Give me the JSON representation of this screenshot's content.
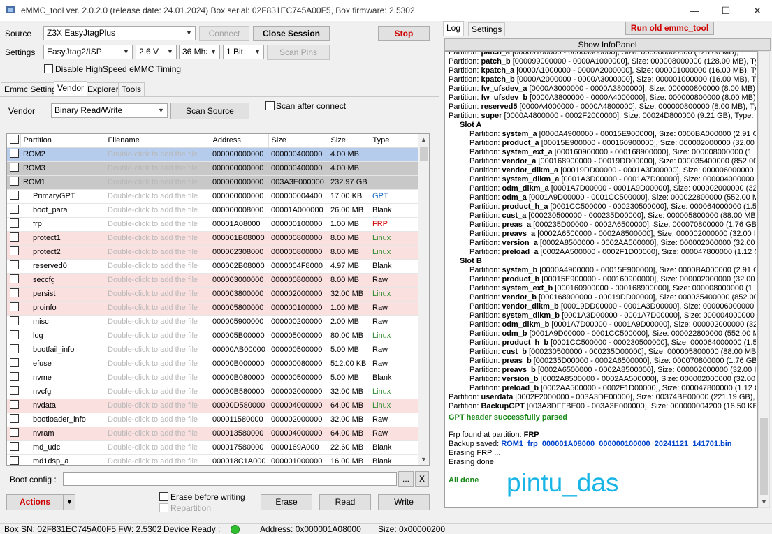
{
  "window": {
    "title": "eMMC_tool ver. 2.0.2.0 (release date: 24.01.2024) Box serial: 02F831EC745A00F5, Box firmware: 2.5302",
    "minimize": "—",
    "maximize": "☐",
    "close": "✕"
  },
  "source": {
    "label": "Source",
    "value": "Z3X EasyJtagPlus",
    "connect": "Connect",
    "close_session": "Close Session",
    "stop": "Stop"
  },
  "settings": {
    "label": "Settings",
    "iface": "EasyJtag2/ISP",
    "voltage": "2.6 V",
    "clock": "36 Mhz",
    "bus": "1 Bit",
    "scan_pins": "Scan Pins",
    "disable_hs": "Disable HighSpeed eMMC Timing"
  },
  "left_tabs": [
    "Emmc Settings",
    "Vendor",
    "Explorer",
    "Tools"
  ],
  "vendor": {
    "label": "Vendor",
    "value": "Binary Read/Write",
    "scan_source": "Scan Source",
    "scan_after": "Scan after connect"
  },
  "grid": {
    "headers": [
      "Partition",
      "Filename",
      "Address",
      "Size",
      "Size",
      "Type"
    ],
    "rows": [
      {
        "name": "ROM2",
        "file": "Double-click to add the file",
        "addr": "000000000000",
        "size": "000000400000",
        "hsize": "4.00 MB",
        "type": "",
        "style": "sel"
      },
      {
        "name": "ROM3",
        "file": "Double-click to add the file",
        "addr": "000000000000",
        "size": "000000400000",
        "hsize": "4.00 MB",
        "type": "",
        "style": "gray"
      },
      {
        "name": "ROM1",
        "file": "Double-click to add the file",
        "addr": "000000000000",
        "size": "003A3E000000",
        "hsize": "232.97 GB",
        "type": "",
        "style": "gray"
      },
      {
        "name": "PrimaryGPT",
        "file": "Double-click to add the file",
        "addr": "000000000000",
        "size": "000000004400",
        "hsize": "17.00 KB",
        "type": "GPT",
        "style": ""
      },
      {
        "name": "boot_para",
        "file": "Double-click to add the file",
        "addr": "000000008000",
        "size": "00001A000000",
        "hsize": "26.00 MB",
        "type": "Blank",
        "style": ""
      },
      {
        "name": "frp",
        "file": "Double-click to add the file",
        "addr": "00001A08000",
        "size": "000000100000",
        "hsize": "1.00 MB",
        "type": "FRP",
        "style": ""
      },
      {
        "name": "protect1",
        "file": "Double-click to add the file",
        "addr": "000001B08000",
        "size": "000000800000",
        "hsize": "8.00 MB",
        "type": "Linux",
        "style": "pink"
      },
      {
        "name": "protect2",
        "file": "Double-click to add the file",
        "addr": "000002308000",
        "size": "000000800000",
        "hsize": "8.00 MB",
        "type": "Linux",
        "style": "pink"
      },
      {
        "name": "reserved0",
        "file": "Double-click to add the file",
        "addr": "000002B08000",
        "size": "0000004F8000",
        "hsize": "4.97 MB",
        "type": "Blank",
        "style": ""
      },
      {
        "name": "seccfg",
        "file": "Double-click to add the file",
        "addr": "000003000000",
        "size": "000000800000",
        "hsize": "8.00 MB",
        "type": "Raw",
        "style": "pink"
      },
      {
        "name": "persist",
        "file": "Double-click to add the file",
        "addr": "000003800000",
        "size": "000002000000",
        "hsize": "32.00 MB",
        "type": "Linux",
        "style": "pink"
      },
      {
        "name": "proinfo",
        "file": "Double-click to add the file",
        "addr": "000005800000",
        "size": "000000100000",
        "hsize": "1.00 MB",
        "type": "Raw",
        "style": "pink"
      },
      {
        "name": "misc",
        "file": "Double-click to add the file",
        "addr": "000005900000",
        "size": "000000200000",
        "hsize": "2.00 MB",
        "type": "Raw",
        "style": ""
      },
      {
        "name": "log",
        "file": "Double-click to add the file",
        "addr": "000005B00000",
        "size": "000005000000",
        "hsize": "80.00 MB",
        "type": "Linux",
        "style": ""
      },
      {
        "name": "bootfail_info",
        "file": "Double-click to add the file",
        "addr": "00000AB00000",
        "size": "000000500000",
        "hsize": "5.00 MB",
        "type": "Raw",
        "style": ""
      },
      {
        "name": "efuse",
        "file": "Double-click to add the file",
        "addr": "00000B000000",
        "size": "000000080000",
        "hsize": "512.00 KB",
        "type": "Raw",
        "style": ""
      },
      {
        "name": "nvme",
        "file": "Double-click to add the file",
        "addr": "00000B080000",
        "size": "000000500000",
        "hsize": "5.00 MB",
        "type": "Blank",
        "style": ""
      },
      {
        "name": "nvcfg",
        "file": "Double-click to add the file",
        "addr": "00000B580000",
        "size": "000002000000",
        "hsize": "32.00 MB",
        "type": "Linux",
        "style": ""
      },
      {
        "name": "nvdata",
        "file": "Double-click to add the file",
        "addr": "00000D580000",
        "size": "000004000000",
        "hsize": "64.00 MB",
        "type": "Linux",
        "style": "pink"
      },
      {
        "name": "bootloader_info",
        "file": "Double-click to add the file",
        "addr": "000011580000",
        "size": "000002000000",
        "hsize": "32.00 MB",
        "type": "Raw",
        "style": ""
      },
      {
        "name": "nvram",
        "file": "Double-click to add the file",
        "addr": "000013580000",
        "size": "000004000000",
        "hsize": "64.00 MB",
        "type": "Raw",
        "style": "pink"
      },
      {
        "name": "md_udc",
        "file": "Double-click to add the file",
        "addr": "000017580000",
        "size": "0000169A000",
        "hsize": "22.60 MB",
        "type": "Blank",
        "style": ""
      },
      {
        "name": "md1dsp_a",
        "file": "Double-click to add the file",
        "addr": "000018C1A000",
        "size": "000001000000",
        "hsize": "16.00 MB",
        "type": "Blank",
        "style": ""
      }
    ]
  },
  "boot_config": {
    "label": "Boot config :",
    "browse": "...",
    "clear": "X"
  },
  "bottom": {
    "actions": "Actions",
    "erase_before": "Erase before writing",
    "repartition": "Repartition",
    "erase": "Erase",
    "read": "Read",
    "write": "Write"
  },
  "right_tabs": [
    "Log",
    "Settings"
  ],
  "run_old": "Run old emmc_tool",
  "show_infopanel": "Show InfoPanel",
  "log": [
    {
      "p": "Partition: ",
      "n": "patch_a",
      "r": " [00009100000 - 00009900000], Size: 000008000000 (128.00 MB), T",
      "i": 0
    },
    {
      "p": "Partition: ",
      "n": "patch_b",
      "r": " [000099000000 - 0000A1000000], Size: 000008000000 (128.00 MB), Ty",
      "i": 0
    },
    {
      "p": "Partition: ",
      "n": "kpatch_a",
      "r": " [0000A1000000 - 0000A2000000], Size: 000001000000 (16.00 MB), Ty",
      "i": 0
    },
    {
      "p": "Partition: ",
      "n": "kpatch_b",
      "r": " [0000A2000000 - 0000A3000000], Size: 000001000000 (16.00 MB), Ty",
      "i": 0
    },
    {
      "p": "Partition: ",
      "n": "fw_ufsdev_a",
      "r": " [0000A3000000 - 0000A3800000], Size: 000000800000 (8.00 MB)",
      "i": 0
    },
    {
      "p": "Partition: ",
      "n": "fw_ufsdev_b",
      "r": " [0000A3800000 - 0000A4000000], Size: 000000800000 (8.00 MB)",
      "i": 0
    },
    {
      "p": "Partition: ",
      "n": "reserved5",
      "r": " [0000A4000000 - 0000A4800000], Size: 000000800000 (8.00 MB), Ty",
      "i": 0
    },
    {
      "p": "Partition: ",
      "n": "super",
      "r": " [0000A4800000 - 0002F2000000], Size: 00024D800000 (9.21 GB), Type: S",
      "i": 0
    },
    {
      "p": "",
      "n": "Slot A",
      "r": "",
      "i": 1
    },
    {
      "p": "Partition: ",
      "n": "system_a",
      "r": " [0000A4900000 - 00015E900000], Size: 0000BA000000 (2.91 G",
      "i": 2
    },
    {
      "p": "Partition: ",
      "n": "product_a",
      "r": " [00015E900000 - 000160900000], Size: 000002000000 (32.00",
      "i": 2
    },
    {
      "p": "Partition: ",
      "n": "system_ext_a",
      "r": " [000160900000 - 000168900000], Size: 000008000000 (1",
      "i": 2
    },
    {
      "p": "Partition: ",
      "n": "vendor_a",
      "r": " [000168900000 - 00019DD00000], Size: 000035400000 (852.00",
      "i": 2
    },
    {
      "p": "Partition: ",
      "n": "vendor_dlkm_a",
      "r": " [00019DD00000 - 0001A3D00000], Size: 000006000000",
      "i": 2
    },
    {
      "p": "Partition: ",
      "n": "system_dlkm_a",
      "r": " [0001A3D00000 - 0001A7D00000], Size: 000004000000",
      "i": 2
    },
    {
      "p": "Partition: ",
      "n": "odm_dlkm_a",
      "r": " [0001A7D00000 - 0001A9D00000], Size: 000002000000 (32",
      "i": 2
    },
    {
      "p": "Partition: ",
      "n": "odm_a",
      "r": " [0001A9D00000 - 0001CC500000], Size: 000022800000 (552.00 M",
      "i": 2
    },
    {
      "p": "Partition: ",
      "n": "product_h_a",
      "r": " [0001CC500000 - 000230500000], Size: 000064000000 (1.5",
      "i": 2
    },
    {
      "p": "Partition: ",
      "n": "cust_a",
      "r": " [000230500000 - 000235D00000], Size: 000005800000 (88.00 MB)",
      "i": 2
    },
    {
      "p": "Partition: ",
      "n": "preas_a",
      "r": " [000235D00000 - 0002A6500000], Size: 000070800000 (1.76 GB)",
      "i": 2
    },
    {
      "p": "Partition: ",
      "n": "preavs_a",
      "r": " [0002A6500000 - 0002A8500000], Size: 000002000000 (32.00 I",
      "i": 2
    },
    {
      "p": "Partition: ",
      "n": "version_a",
      "r": " [0002A8500000 - 0002AA500000], Size: 000002000000 (32.00",
      "i": 2
    },
    {
      "p": "Partition: ",
      "n": "preload_a",
      "r": " [0002AA500000 - 0002F1D00000], Size: 000047800000 (1.12 G",
      "i": 2
    },
    {
      "p": "",
      "n": "Slot B",
      "r": "",
      "i": 1
    },
    {
      "p": "Partition: ",
      "n": "system_b",
      "r": " [0000A4900000 - 00015E900000], Size: 0000BA000000 (2.91 G",
      "i": 2
    },
    {
      "p": "Partition: ",
      "n": "product_b",
      "r": " [00015E900000 - 000160900000], Size: 000002000000 (32.00",
      "i": 2
    },
    {
      "p": "Partition: ",
      "n": "system_ext_b",
      "r": " [000160900000 - 000168900000], Size: 000008000000 (1",
      "i": 2
    },
    {
      "p": "Partition: ",
      "n": "vendor_b",
      "r": " [000168900000 - 00019DD00000], Size: 000035400000 (852.00",
      "i": 2
    },
    {
      "p": "Partition: ",
      "n": "vendor_dlkm_b",
      "r": " [00019DD00000 - 0001A3D00000], Size: 000006000000",
      "i": 2
    },
    {
      "p": "Partition: ",
      "n": "system_dlkm_b",
      "r": " [0001A3D00000 - 0001A7D00000], Size: 000004000000",
      "i": 2
    },
    {
      "p": "Partition: ",
      "n": "odm_dlkm_b",
      "r": " [0001A7D00000 - 0001A9D00000], Size: 000002000000 (32",
      "i": 2
    },
    {
      "p": "Partition: ",
      "n": "odm_b",
      "r": " [0001A9D00000 - 0001CC500000], Size: 000022800000 (552.00 M",
      "i": 2
    },
    {
      "p": "Partition: ",
      "n": "product_h_b",
      "r": " [0001CC500000 - 000230500000], Size: 000064000000 (1.5",
      "i": 2
    },
    {
      "p": "Partition: ",
      "n": "cust_b",
      "r": " [000230500000 - 000235D00000], Size: 000005800000 (88.00 MB)",
      "i": 2
    },
    {
      "p": "Partition: ",
      "n": "preas_b",
      "r": " [000235D00000 - 0002A6500000], Size: 000070800000 (1.76 GB)",
      "i": 2
    },
    {
      "p": "Partition: ",
      "n": "preavs_b",
      "r": " [0002A6500000 - 0002A8500000], Size: 000002000000 (32.00 I",
      "i": 2
    },
    {
      "p": "Partition: ",
      "n": "version_b",
      "r": " [0002A8500000 - 0002AA500000], Size: 000002000000 (32.00",
      "i": 2
    },
    {
      "p": "Partition: ",
      "n": "preload_b",
      "r": " [0002AA500000 - 0002F1D00000], Size: 000047800000 (1.12 G",
      "i": 2
    },
    {
      "p": "Partition: ",
      "n": "userdata",
      "r": " [0002F2000000 - 003A3DE00000], Size: 00374BE00000 (221.19 GB), T",
      "i": 0
    },
    {
      "p": "Partition: ",
      "n": "BackupGPT",
      "r": " [003A3DFFBE00 - 003A3E000000], Size: 000000004200 (16.50 KB),",
      "i": 0
    }
  ],
  "log_success": "GPT header successfully parsed",
  "log_frp_prefix": "Frp found at partition: ",
  "log_frp_name": "FRP",
  "log_backup_prefix": "Backup saved: ",
  "log_backup_file": "ROM1_frp_000001A08000_000000100000_20241121_141701.bin",
  "log_erasing": "Erasing FRP ...",
  "log_erase_done": "Erasing done",
  "log_all_done": "All done",
  "watermark": "pintu_das",
  "status": {
    "box_sn": "Box SN:  02F831EC745A00F5  FW:  2.5302",
    "device": "Device Ready :",
    "address": "Address: 0x000001A08000",
    "size": "Size: 0x00000200"
  },
  "colors": {
    "accent_green": "#2fbf2f",
    "stop_red": "#d00000",
    "watermark": "#19b5e6"
  }
}
